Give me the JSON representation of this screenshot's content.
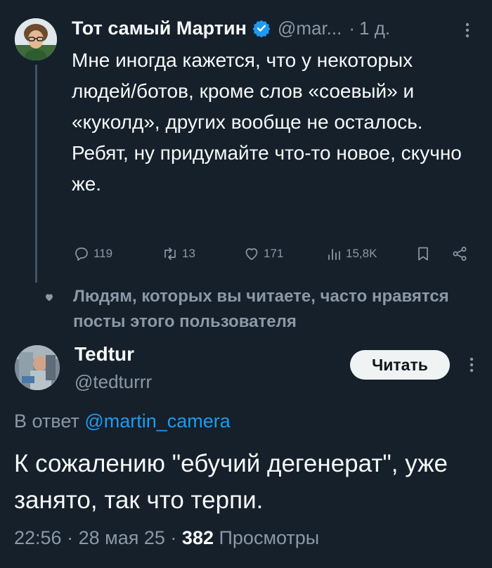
{
  "tweet": {
    "author_name": "Тот самый Мартин",
    "handle": "@mar...",
    "separator": "·",
    "time": "1 д.",
    "text": "Мне иногда кажется, что у некоторых людей/ботов, кроме слов «соевый» и «куколд», других вообще не осталось. Ребят, ну придумайте что-то новое, скучно же.",
    "stats": {
      "replies": "119",
      "retweets": "13",
      "likes": "171",
      "views": "15,8K"
    }
  },
  "social_context": "Людям, которых вы читаете, часто нравятся посты этого пользователя",
  "reply": {
    "author_name": "Tedtur",
    "handle": "@tedturrr",
    "follow_label": "Читать",
    "reply_to_prefix": "В ответ ",
    "reply_to_mention": "@martin_camera",
    "text": "К сожалению \"ебучий дегенерат\", уже занято, так что терпи.",
    "time": "22:56",
    "date": "28 мая 25",
    "dot": "·",
    "views_count": "382",
    "views_label": "Просмотры"
  },
  "colors": {
    "background": "#15202b",
    "text": "#f7f9f9",
    "secondary": "#8b98a5",
    "accent": "#1d9bf0",
    "verified": "#1d9bf0"
  },
  "icons": [
    "verified-badge-icon",
    "more-icon",
    "reply-icon",
    "retweet-icon",
    "like-icon",
    "views-icon",
    "bookmark-icon",
    "share-icon",
    "heart-icon"
  ]
}
